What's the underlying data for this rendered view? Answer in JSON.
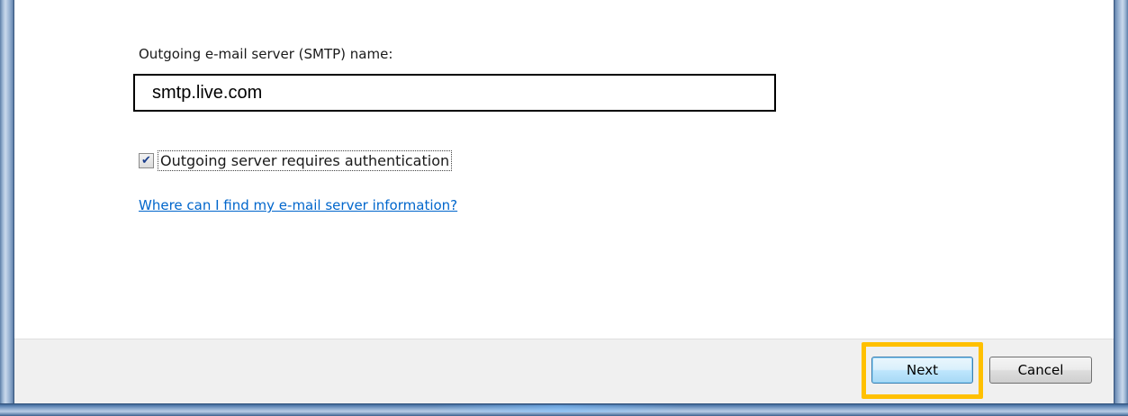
{
  "form": {
    "smtp_label": "Outgoing e-mail server (SMTP) name:",
    "smtp_value": "smtp.live.com",
    "auth_checkbox_checked": true,
    "auth_checkbox_label": "Outgoing server requires authentication",
    "help_link": "Where can I find my e-mail server information?"
  },
  "buttons": {
    "next_label": "Next",
    "cancel_label": "Cancel"
  },
  "colors": {
    "highlight": "#ffc000",
    "link": "#0066cc",
    "frame": "#2b4a72"
  },
  "icons": {
    "checkbox_mark": "✔"
  }
}
